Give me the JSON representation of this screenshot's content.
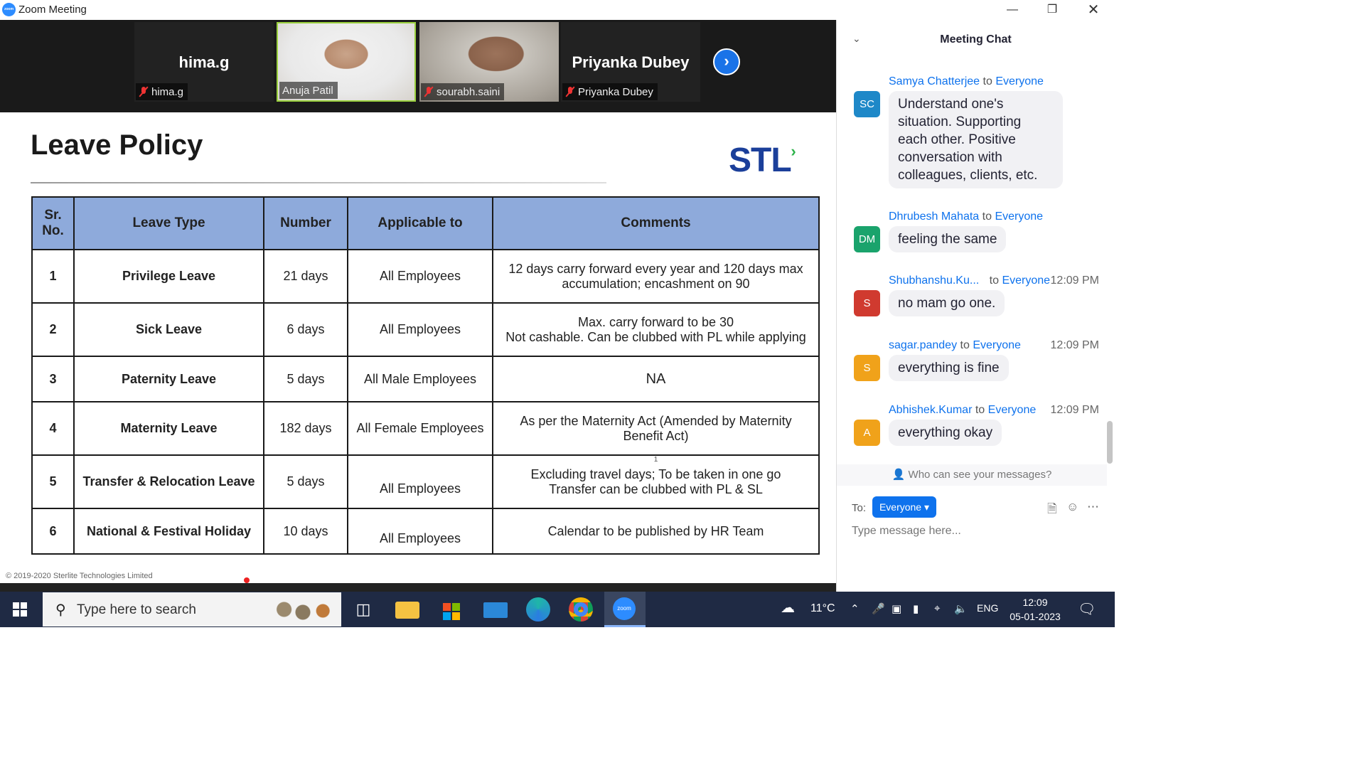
{
  "window": {
    "title": "Zoom Meeting",
    "app_icon_text": "zoom"
  },
  "participants": [
    {
      "display_name": "hima.g",
      "tag_name": "hima.g",
      "video": false,
      "muted": true
    },
    {
      "display_name": "",
      "tag_name": "Anuja Patil",
      "video": true,
      "muted": false,
      "active_speaker": true
    },
    {
      "display_name": "",
      "tag_name": "sourabh.saini",
      "video": true,
      "muted": true
    },
    {
      "display_name": "Priyanka Dubey",
      "tag_name": "Priyanka Dubey",
      "video": false,
      "muted": true
    }
  ],
  "slide": {
    "title": "Leave Policy",
    "logo": "STL",
    "headers": [
      "Sr. No.",
      "Leave Type",
      "Number",
      "Applicable to",
      "Comments"
    ],
    "rows": [
      {
        "no": "1",
        "type": "Privilege Leave",
        "number": "21 days",
        "applicable": "All Employees",
        "comments": "12 days carry forward every year and 120 days max accumulation; encashment on 90"
      },
      {
        "no": "2",
        "type": "Sick Leave",
        "number": "6 days",
        "applicable": "All Employees",
        "comments": "Max. carry forward to be 30\nNot cashable. Can be clubbed with PL while applying"
      },
      {
        "no": "3",
        "type": "Paternity Leave",
        "number": "5 days",
        "applicable": "All Male Employees",
        "comments": "NA"
      },
      {
        "no": "4",
        "type": "Maternity Leave",
        "number": "182 days",
        "applicable": "All Female Employees",
        "comments": "As per the Maternity Act  (Amended by Maternity Benefit Act)"
      },
      {
        "no": "5",
        "type": "Transfer & Relocation Leave",
        "number": "5 days",
        "applicable": "All Employees",
        "comments": "Excluding travel days; To be taken in one go\nTransfer can be clubbed with PL & SL"
      },
      {
        "no": "6",
        "type": "National & Festival Holiday",
        "number": "10 days",
        "applicable": "All Employees",
        "comments": "Calendar to be published by HR Team"
      }
    ],
    "footnote_marker": "1",
    "copyright": "© 2019-2020 Sterlite Technologies Limited"
  },
  "chat": {
    "title": "Meeting Chat",
    "messages": [
      {
        "initials": "SC",
        "avatar_color": "#1e88c8",
        "sender": "Samya Chatterjee",
        "to": "to",
        "recipient": "Everyone",
        "time": "",
        "text": "Understand one's situation. Supporting each other. Positive conversation with colleagues, clients, etc."
      },
      {
        "initials": "DM",
        "avatar_color": "#1aa36c",
        "sender": "Dhrubesh Mahata",
        "to": "to",
        "recipient": "Everyone",
        "time": "",
        "text": "feeling the same"
      },
      {
        "initials": "S",
        "avatar_color": "#d03a2f",
        "sender": "Shubhanshu.Ku...",
        "to": "to",
        "recipient": "Everyone",
        "time": "12:09 PM",
        "text": "no mam go one."
      },
      {
        "initials": "S",
        "avatar_color": "#f0a21a",
        "sender": "sagar.pandey",
        "to": "to",
        "recipient": "Everyone",
        "time": "12:09 PM",
        "text": "everything is fine"
      },
      {
        "initials": "A",
        "avatar_color": "#f0a21a",
        "sender": "Abhishek.Kumar",
        "to": "to",
        "recipient": "Everyone",
        "time": "12:09 PM",
        "text": "everything okay"
      }
    ],
    "who_can_see": "Who can see your messages?",
    "to_label": "To:",
    "recipient_select": "Everyone",
    "input_placeholder": "Type message here..."
  },
  "taskbar": {
    "search_placeholder": "Type here to search",
    "weather": "11°C",
    "language": "ENG",
    "time": "12:09",
    "date": "05-01-2023"
  }
}
